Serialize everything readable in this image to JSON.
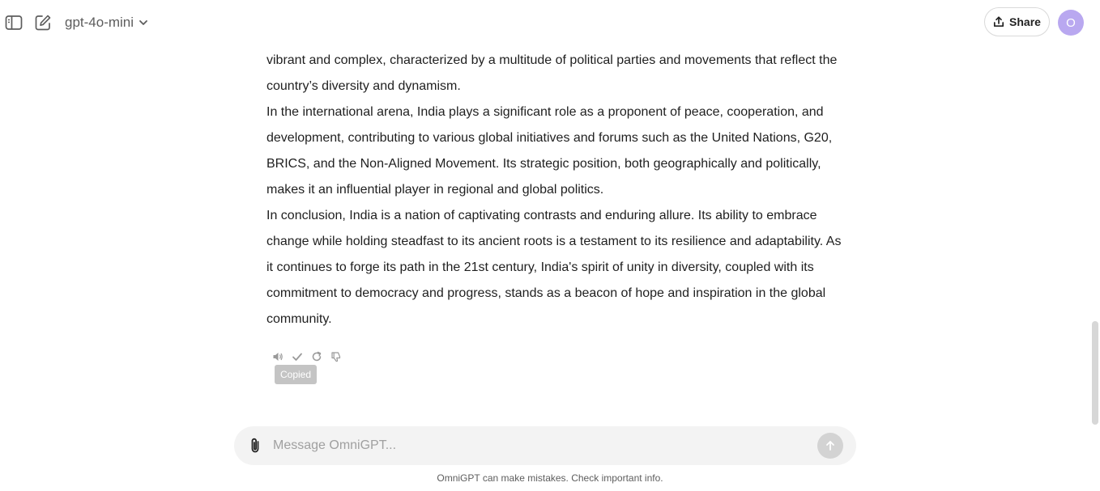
{
  "header": {
    "model_name": "gpt-4o-mini",
    "share_label": "Share",
    "avatar_initial": "O"
  },
  "conversation": {
    "paragraphs": [
      "vibrant and complex, characterized by a multitude of political parties and movements that reflect the country’s diversity and dynamism.",
      "In the international arena, India plays a significant role as a proponent of peace, cooperation, and development, contributing to various global initiatives and forums such as the United Nations, G20, BRICS, and the Non-Aligned Movement. Its strategic position, both geographically and politically, makes it an influential player in regional and global politics.",
      "In conclusion, India is a nation of captivating contrasts and enduring allure. Its ability to embrace change while holding steadfast to its ancient roots is a testament to its resilience and adaptability. As it continues to forge its path in the 21st century, India's spirit of unity in diversity, coupled with its commitment to democracy and progress, stands as a beacon of hope and inspiration in the global community."
    ],
    "actions": {
      "icons": [
        "speaker-icon",
        "check-icon",
        "regenerate-icon",
        "thumbs-down-icon"
      ],
      "tooltip": "Copied"
    }
  },
  "composer": {
    "placeholder": "Message OmniGPT...",
    "value": ""
  },
  "footer": {
    "disclaimer": "OmniGPT can make mistakes. Check important info."
  },
  "colors": {
    "avatar_bg": "#b9a8f0",
    "composer_bg": "#f3f3f3",
    "send_button_bg": "#d3d3d3",
    "tooltip_bg": "#c4c4c4"
  }
}
